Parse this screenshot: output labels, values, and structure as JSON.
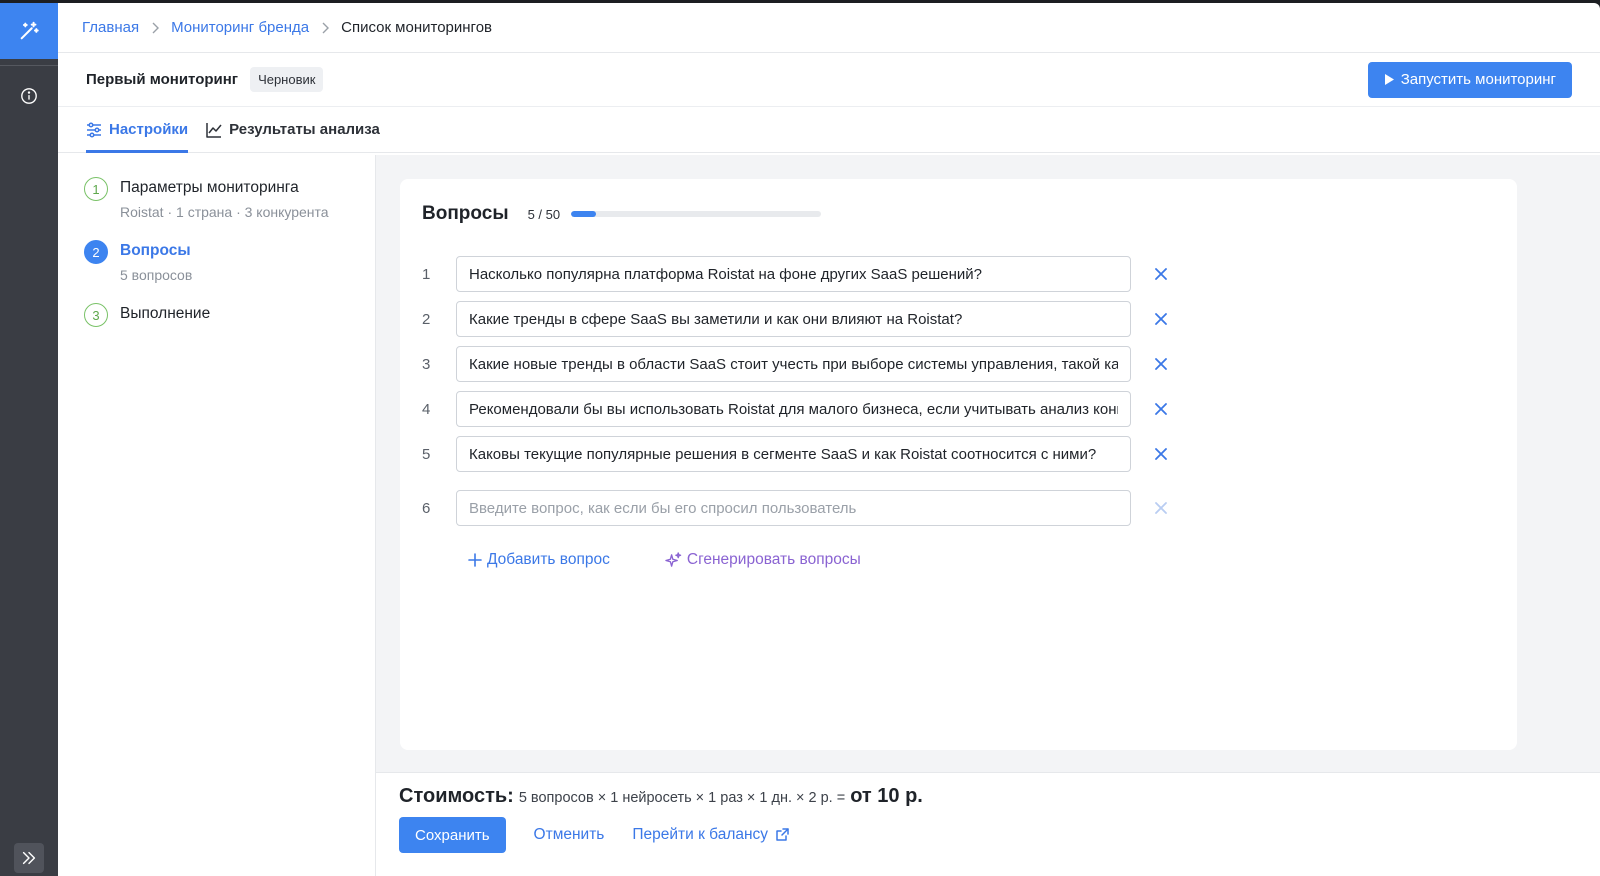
{
  "rail": {
    "logo_icon": "magic-wand-icon",
    "info_icon": "info-circle-icon",
    "expand_icon": "double-chevron-right-icon"
  },
  "breadcrumbs": [
    "Главная",
    "Мониторинг бренда",
    "Список мониторингов"
  ],
  "header": {
    "title": "Первый мониторинг",
    "status_badge": "Черновик",
    "run_button": "Запустить мониторинг"
  },
  "tabs": [
    {
      "label": "Настройки",
      "icon": "sliders-icon",
      "active": true
    },
    {
      "label": "Результаты анализа",
      "icon": "line-chart-icon",
      "active": false
    }
  ],
  "steps": [
    {
      "num": "1",
      "title": "Параметры мониторинга",
      "subtitle": "Roistat · 1 страна · 3 конкурента",
      "state": "done"
    },
    {
      "num": "2",
      "title": "Вопросы",
      "subtitle": "5 вопросов",
      "state": "active"
    },
    {
      "num": "3",
      "title": "Выполнение",
      "subtitle": "",
      "state": "pending"
    }
  ],
  "questions": {
    "heading": "Вопросы",
    "counter": "5 / 50",
    "progress_fraction": 0.1,
    "items": [
      {
        "num": "1",
        "value": "Насколько популярна платформа Roistat на фоне других SaaS решений?"
      },
      {
        "num": "2",
        "value": "Какие тренды в сфере SaaS вы заметили и как они влияют на Roistat?"
      },
      {
        "num": "3",
        "value": "Какие новые тренды в области SaaS стоит учесть при выборе системы управления, такой как Roistat?"
      },
      {
        "num": "4",
        "value": "Рекомендовали бы вы использовать Roistat для малого бизнеса, если учитывать анализ конкурентов?"
      },
      {
        "num": "5",
        "value": "Каковы текущие популярные решения в сегменте SaaS и как Roistat соотносится с ними?"
      }
    ],
    "new_item": {
      "num": "6",
      "placeholder": "Введите вопрос, как если бы его спросил пользователь"
    },
    "add_label": "Добавить вопрос",
    "generate_label": "Сгенерировать вопросы"
  },
  "footer": {
    "cost_label": "Стоимость:",
    "cost_formula": "5 вопросов × 1 нейросеть × 1 раз × 1 дн. × 2 р. =",
    "cost_total": "от 10 р.",
    "save_button": "Сохранить",
    "cancel_link": "Отменить",
    "balance_link": "Перейти к балансу"
  },
  "colors": {
    "accent": "#3d84f0",
    "step_done": "#79c267",
    "generate": "#8a63d2",
    "rail": "#3a3d44"
  }
}
